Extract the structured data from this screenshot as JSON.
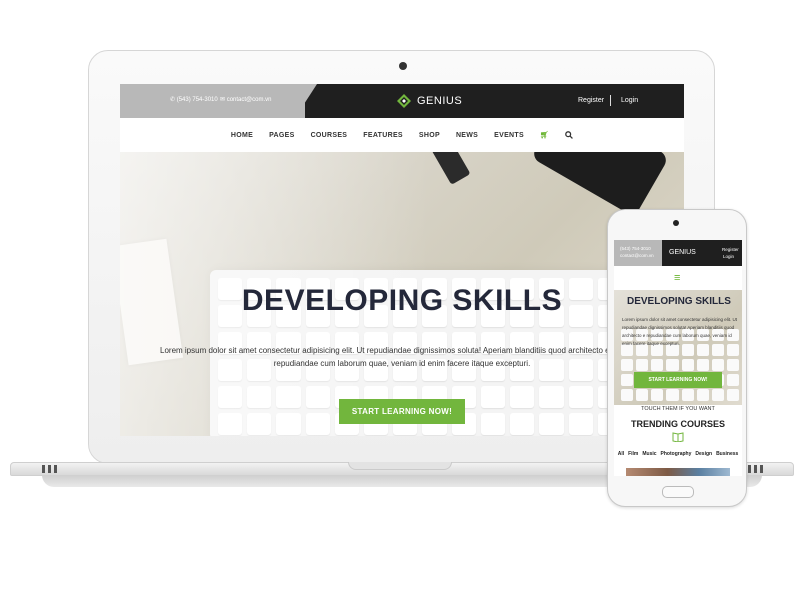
{
  "laptop_site": {
    "topbar": {
      "phone": "(543) 754-3010",
      "email": "contact@com.vn",
      "brand": "GENIUS",
      "register": "Register",
      "login": "Login"
    },
    "nav": {
      "items": [
        {
          "label": "HOME"
        },
        {
          "label": "PAGES"
        },
        {
          "label": "COURSES"
        },
        {
          "label": "FEATURES"
        },
        {
          "label": "SHOP"
        },
        {
          "label": "NEWS"
        },
        {
          "label": "EVENTS"
        }
      ]
    },
    "hero": {
      "headline": "DEVELOPING SKILLS",
      "desc_line1": "Lorem ipsum dolor sit amet consectetur adipisicing elit. Ut repudiandae dignissimos soluta! Aperiam blanditiis quod architecto e",
      "desc_line2": "repudiandae cum laborum quae, veniam id enim facere itaque excepturi.",
      "cta": "START LEARNING NOW!"
    }
  },
  "phone_site": {
    "topbar": {
      "phone": "(543) 754-3010",
      "email": "contact@com.vn",
      "brand": "GENIUS",
      "register": "Register",
      "login": "Login"
    },
    "menu_glyph": "≡",
    "hero": {
      "headline": "DEVELOPING SKILLS",
      "desc": "Lorem ipsum dolor sit amet consectetur adipisicing elit. Ut repudiandae dignissimos soluta! Aperiam blanditiis quod architecto e repudiandae cum laborum quae, veniam id enim facere itaque excepturi.",
      "cta": "START LEARNING NOW!"
    },
    "touch_text": "TOUCH THEM IF YOU WANT",
    "trending_title": "TRENDING COURSES",
    "categories": [
      "All",
      "Film",
      "Music",
      "Photography",
      "Design",
      "Business"
    ]
  },
  "colors": {
    "accent_green": "#72b63d",
    "topbar_dark": "#1f1f1f",
    "topbar_gray": "#b8b8b8",
    "headline": "#24283a"
  }
}
